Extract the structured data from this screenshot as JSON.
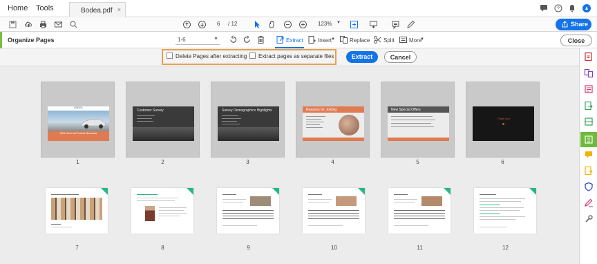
{
  "menu": {
    "home": "Home",
    "tools": "Tools"
  },
  "document_tab": {
    "title": "Bodea.pdf",
    "close": "×"
  },
  "toolbar": {
    "page_current": "6",
    "page_total": "/ 12",
    "zoom": "123%",
    "share_label": "Share"
  },
  "organize_bar": {
    "title": "Organize Pages",
    "range_value": "1-6",
    "tools": {
      "extract": "Extract",
      "insert": "Insert",
      "replace": "Replace",
      "split": "Split",
      "more": "More"
    },
    "close_label": "Close"
  },
  "extract_options": {
    "delete_after": "Delete Pages after extracting",
    "separate_files": "Extract pages as separate files",
    "extract_button": "Extract",
    "cancel_button": "Cancel"
  },
  "pages_row1": [
    {
      "number": "1",
      "style": "title-slide",
      "slide_title": "BODEA",
      "slide_sub": "2021 New Leaf Product Showcase"
    },
    {
      "number": "2",
      "style": "dark-slide",
      "slide_title": "Customer Survey"
    },
    {
      "number": "3",
      "style": "dark-slide",
      "slide_title": "Survey Demographics Highlights"
    },
    {
      "number": "4",
      "style": "grey-slide",
      "slide_title": "Reasons for Joining"
    },
    {
      "number": "5",
      "style": "grey-slide",
      "slide_title": "New Special Offers"
    },
    {
      "number": "6",
      "style": "black-slide",
      "slide_title": "Thank you"
    }
  ],
  "pages_row2": [
    {
      "number": "7"
    },
    {
      "number": "8"
    },
    {
      "number": "9"
    },
    {
      "number": "10"
    },
    {
      "number": "11"
    },
    {
      "number": "12"
    }
  ],
  "colors": {
    "accent_blue": "#1473e6",
    "highlight_orange": "#e8a04c",
    "organize_green": "#7bbf42",
    "page_corner_green": "#2bb58a",
    "slide_orange": "#e07b51"
  }
}
